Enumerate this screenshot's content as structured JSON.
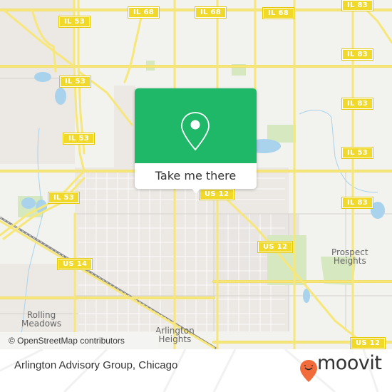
{
  "map": {
    "attribution": "© OpenStreetMap contributors",
    "popup": {
      "button_label": "Take me there",
      "icon": "map-pin-icon",
      "color": "#1eb868"
    },
    "road_shields": [
      {
        "id": "il53-top",
        "label": "IL 53"
      },
      {
        "id": "il68-left",
        "label": "IL 68"
      },
      {
        "id": "il68-mid",
        "label": "IL 68"
      },
      {
        "id": "il68-right",
        "label": "IL 68"
      },
      {
        "id": "il83-1",
        "label": "IL 83"
      },
      {
        "id": "il53-mid",
        "label": "IL 53"
      },
      {
        "id": "il83-2",
        "label": "IL 83"
      },
      {
        "id": "il53-west",
        "label": "IL 53"
      },
      {
        "id": "il83-3",
        "label": "IL 83"
      },
      {
        "id": "il53-sw",
        "label": "IL 53"
      },
      {
        "id": "us12-a",
        "label": "US 12"
      },
      {
        "id": "il83-4",
        "label": "IL 83"
      },
      {
        "id": "il53-edge",
        "label": "IL 53"
      },
      {
        "id": "us12-b",
        "label": "US 12"
      },
      {
        "id": "us14",
        "label": "US 14"
      },
      {
        "id": "us12-c",
        "label": "US 12"
      }
    ],
    "places": [
      {
        "id": "prospect-heights",
        "lines": [
          "Prospect",
          "Heights"
        ]
      },
      {
        "id": "rolling-meadows",
        "lines": [
          "Rolling",
          "Meadows"
        ]
      },
      {
        "id": "arlington-heights",
        "lines": [
          "Arlington",
          "Heights"
        ]
      }
    ],
    "colors": {
      "background": "#f2f2ee",
      "road": "#f5e06a",
      "water": "#a9d3ec",
      "park": "#d6e8bf",
      "urban": "#ece8e4"
    }
  },
  "footer": {
    "title": "Arlington Advisory Group, Chicago",
    "brand": "moovit",
    "brand_color": "#f26b3a"
  }
}
